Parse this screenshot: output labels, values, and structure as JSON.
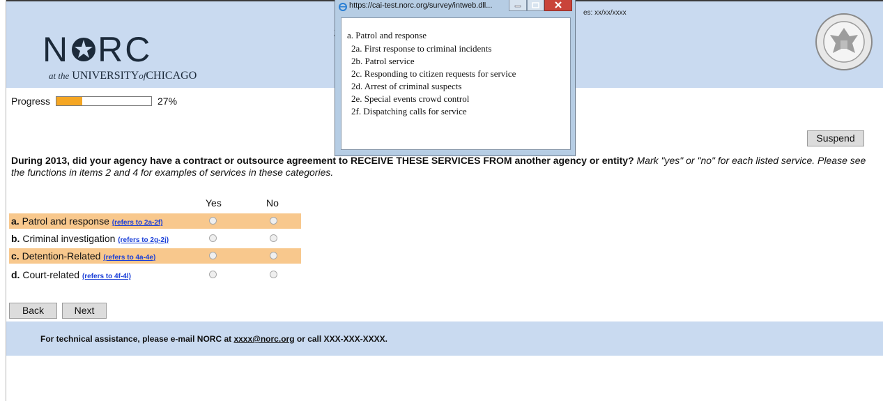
{
  "banner": {
    "logo_text": "N RC",
    "logo_star_letter": "O",
    "logo_sub_at_the": "at the",
    "logo_sub_university": "UNIVERSITY",
    "logo_sub_of": "of",
    "logo_sub_chicago": "CHICAGO",
    "title_fragment": "2",
    "date_fragment": "es: xx/xx/xxxx",
    "seal_icon": "department-of-justice-seal-icon"
  },
  "progress": {
    "label": "Progress",
    "value_percent": 27,
    "value_text": "27%",
    "fill_color": "#f5a623"
  },
  "suspend_label": "Suspend",
  "question": {
    "bold": "During 2013, did your agency have a contract or outsource agreement to RECEIVE THESE SERVICES FROM another agency or entity?",
    "italic": "Mark \"yes\" or \"no\" for each listed service. Please see the functions in items 2 and 4 for examples of services in these categories."
  },
  "grid": {
    "col_yes": "Yes",
    "col_no": "No",
    "rows": [
      {
        "letter": "a.",
        "label": "Patrol and response",
        "ref": "(refers to 2a-2f)",
        "shaded": true
      },
      {
        "letter": "b.",
        "label": "Criminal investigation",
        "ref": "(refers to 2g-2j)",
        "shaded": false
      },
      {
        "letter": "c.",
        "label": "Detention-Related",
        "ref": "(refers to 4a-4e)",
        "shaded": true
      },
      {
        "letter": "d.",
        "label": "Court-related",
        "ref": "(refers to 4f-4l)",
        "shaded": false
      }
    ]
  },
  "nav": {
    "back_label": "Back",
    "next_label": "Next"
  },
  "footer": {
    "text_before": "For technical assistance, please e-mail NORC at",
    "email": "xxxx@norc.org",
    "text_after": "or call XXX-XXX-XXXX."
  },
  "popup": {
    "title": "https://cai-test.norc.org/survey/intweb.dll...",
    "lines": [
      "a. Patrol and response",
      "2a. First response to criminal incidents",
      "2b. Patrol service",
      "2c. Responding to citizen requests for service",
      "2d. Arrest of criminal suspects",
      "2e. Special events crowd control",
      "2f. Dispatching calls for service"
    ],
    "controls": [
      "minimize-icon",
      "maximize-icon",
      "close-icon"
    ]
  },
  "colors": {
    "banner": "#c9daf0",
    "row_shade": "#f8c88d",
    "link": "#1a3fd8",
    "progress": "#f5a623"
  }
}
